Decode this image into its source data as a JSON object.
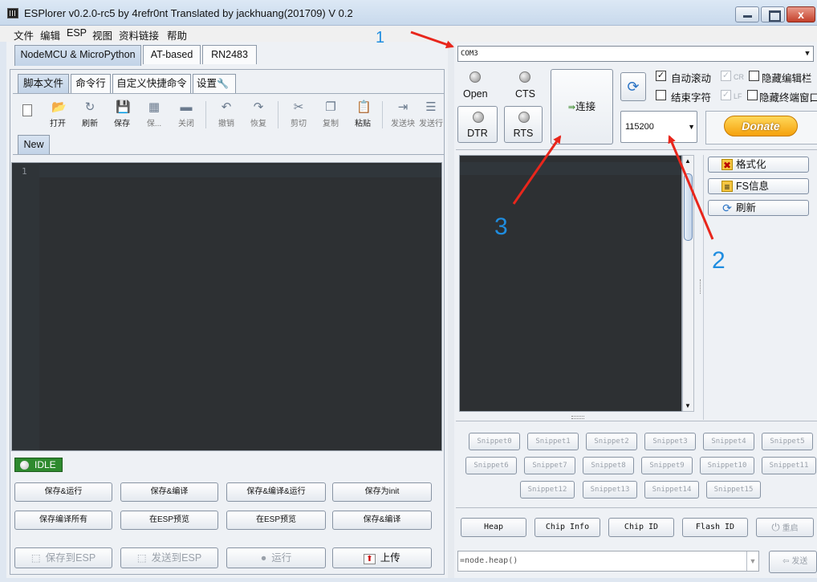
{
  "window": {
    "title": "ESPlorer v0.2.0-rc5 by 4refr0nt Translated by jackhuang(201709) V 0.2",
    "close_glyph": "x"
  },
  "menu": [
    "文件",
    "编辑",
    "ESP",
    "视图",
    "资料链接",
    "帮助"
  ],
  "left": {
    "top_tabs": [
      "NodeMCU & MicroPython",
      "AT-based",
      "RN2483"
    ],
    "sub_tabs": [
      "脚本文件",
      "命令行",
      "自定义快捷命令",
      "设置"
    ],
    "toolbar": [
      {
        "label": "打开",
        "icon": "📂"
      },
      {
        "label": "刷新",
        "icon": "↻"
      },
      {
        "label": "保存",
        "icon": "💾"
      },
      {
        "label": "保...",
        "icon": "▦"
      },
      {
        "label": "关闭",
        "icon": "▬"
      },
      {
        "label": "撤销",
        "icon": "↶"
      },
      {
        "label": "恢复",
        "icon": "↷"
      },
      {
        "label": "剪切",
        "icon": "✂"
      },
      {
        "label": "复制",
        "icon": "❐"
      },
      {
        "label": "粘贴",
        "icon": "📋"
      },
      {
        "label": "发送块",
        "icon": "⇥"
      },
      {
        "label": "发送行",
        "icon": "☰"
      }
    ],
    "file_tab": "New",
    "line_number": "1",
    "status": "IDLE",
    "actions_row1": [
      "保存&运行",
      "保存&编译",
      "保存&编译&运行",
      "保存为init"
    ],
    "actions_row2": [
      "保存编译所有",
      "在ESP预览",
      "在ESP预览",
      "保存&编译"
    ],
    "bottom": [
      "保存到ESP",
      "发送到ESP",
      "运行",
      "上传"
    ]
  },
  "right": {
    "port": "COM3",
    "open_label": "Open",
    "cts_label": "CTS",
    "dtr_label": "DTR",
    "rts_label": "RTS",
    "connect_label": "连接",
    "baud": "115200",
    "autoscroll_label": "自动滚动",
    "autoscroll_checked": "✓",
    "cr_label": "CR",
    "cr_checked": "✓",
    "hide_editor_label": "隐藏编辑栏",
    "eol_label": "结束字符",
    "lf_label": "LF",
    "lf_checked": "✓",
    "hide_terminal_label": "隐藏终端窗口",
    "donate_label": "Donate",
    "side_buttons": [
      "格式化",
      "FS信息",
      "刷新"
    ],
    "snippets": [
      "Snippet0",
      "Snippet1",
      "Snippet2",
      "Snippet3",
      "Snippet4",
      "Snippet5",
      "Snippet6",
      "Snippet7",
      "Snippet8",
      "Snippet9",
      "Snippet10",
      "Snippet11",
      "Snippet12",
      "Snippet13",
      "Snippet14",
      "Snippet15"
    ],
    "info_buttons": [
      "Heap",
      "Chip Info",
      "Chip ID",
      "Flash ID"
    ],
    "reset_label": "重启",
    "command": "=node.heap()",
    "send_label": "发送"
  },
  "annotations": [
    "1",
    "2",
    "3"
  ]
}
